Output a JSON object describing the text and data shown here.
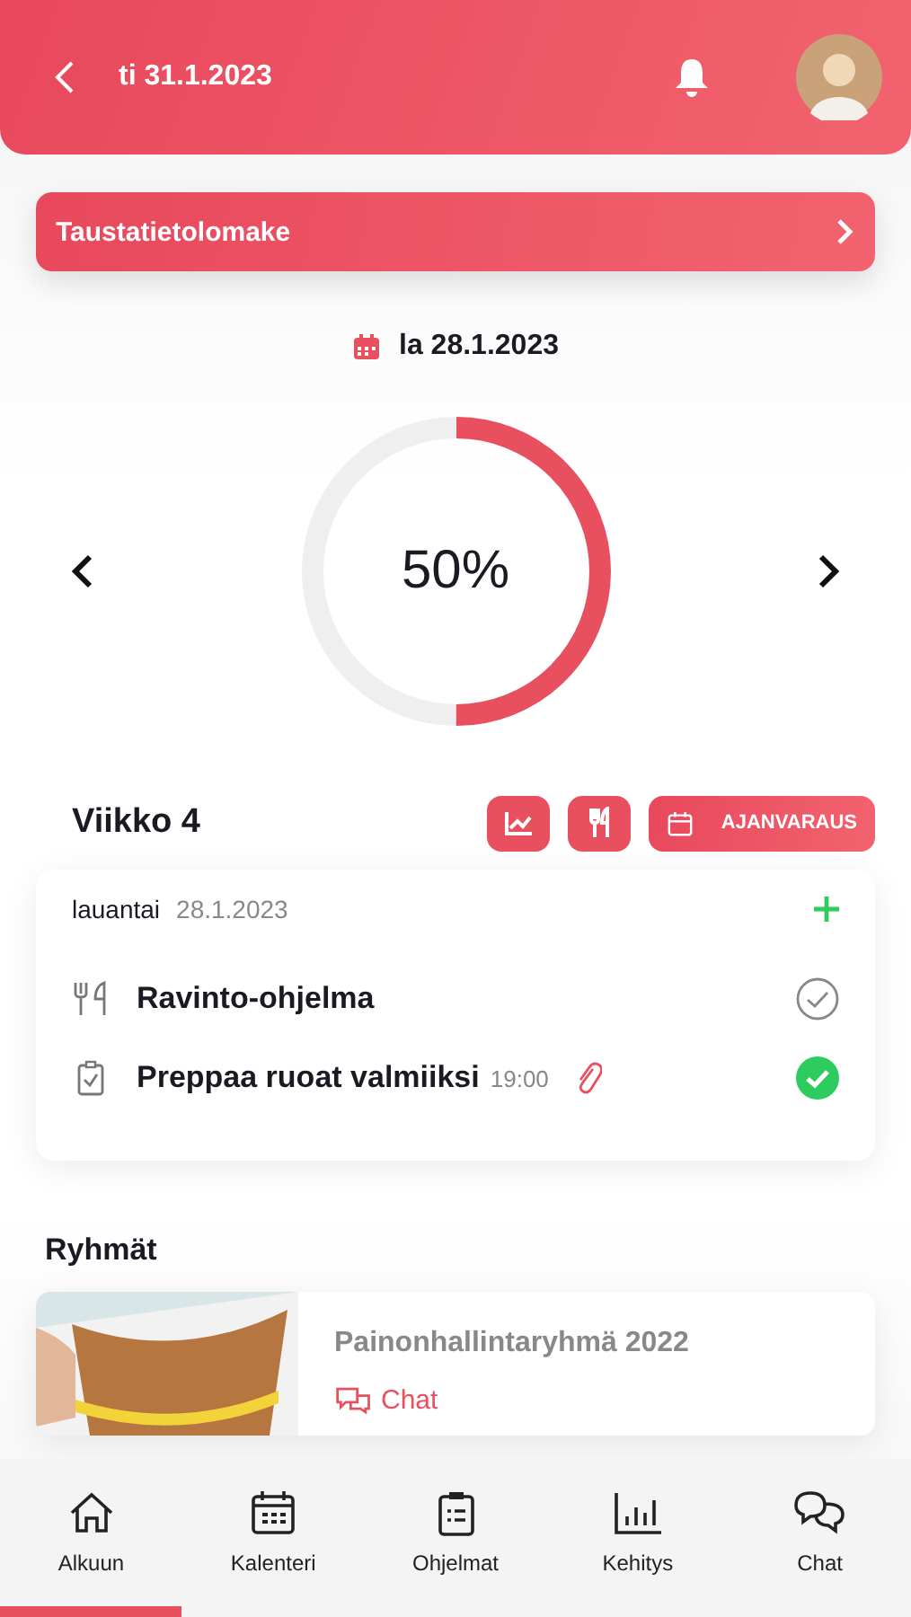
{
  "header": {
    "date": "ti 31.1.2023"
  },
  "banner": {
    "label": "Taustatietolomake"
  },
  "day": {
    "date": "la 28.1.2023",
    "progress": {
      "level": 0.5,
      "reading": "50%"
    }
  },
  "week": {
    "title": "Viikko 4",
    "booking_label": "AJANVARAUS"
  },
  "day_card": {
    "weekday": "lauantai",
    "date": "28.1.2023",
    "tasks": [
      {
        "kind": "nutrition",
        "title": "Ravinto-ohjelma",
        "done": false
      },
      {
        "kind": "task",
        "title": "Preppaa ruoat valmiiksi",
        "time": "19:00",
        "attachment": true,
        "done": true
      }
    ]
  },
  "groups": {
    "title": "Ryhmät",
    "items": [
      {
        "name": "Painonhallintaryhmä 2022",
        "chat_label": "Chat"
      }
    ]
  },
  "nav": [
    {
      "label": "Alkuun",
      "kind": "home",
      "selected": true
    },
    {
      "label": "Kalenteri",
      "kind": "calendar",
      "selected": false
    },
    {
      "label": "Ohjelmat",
      "kind": "programs",
      "selected": false
    },
    {
      "label": "Kehitys",
      "kind": "progress",
      "selected": false
    },
    {
      "label": "Chat",
      "kind": "chat",
      "selected": false
    }
  ]
}
